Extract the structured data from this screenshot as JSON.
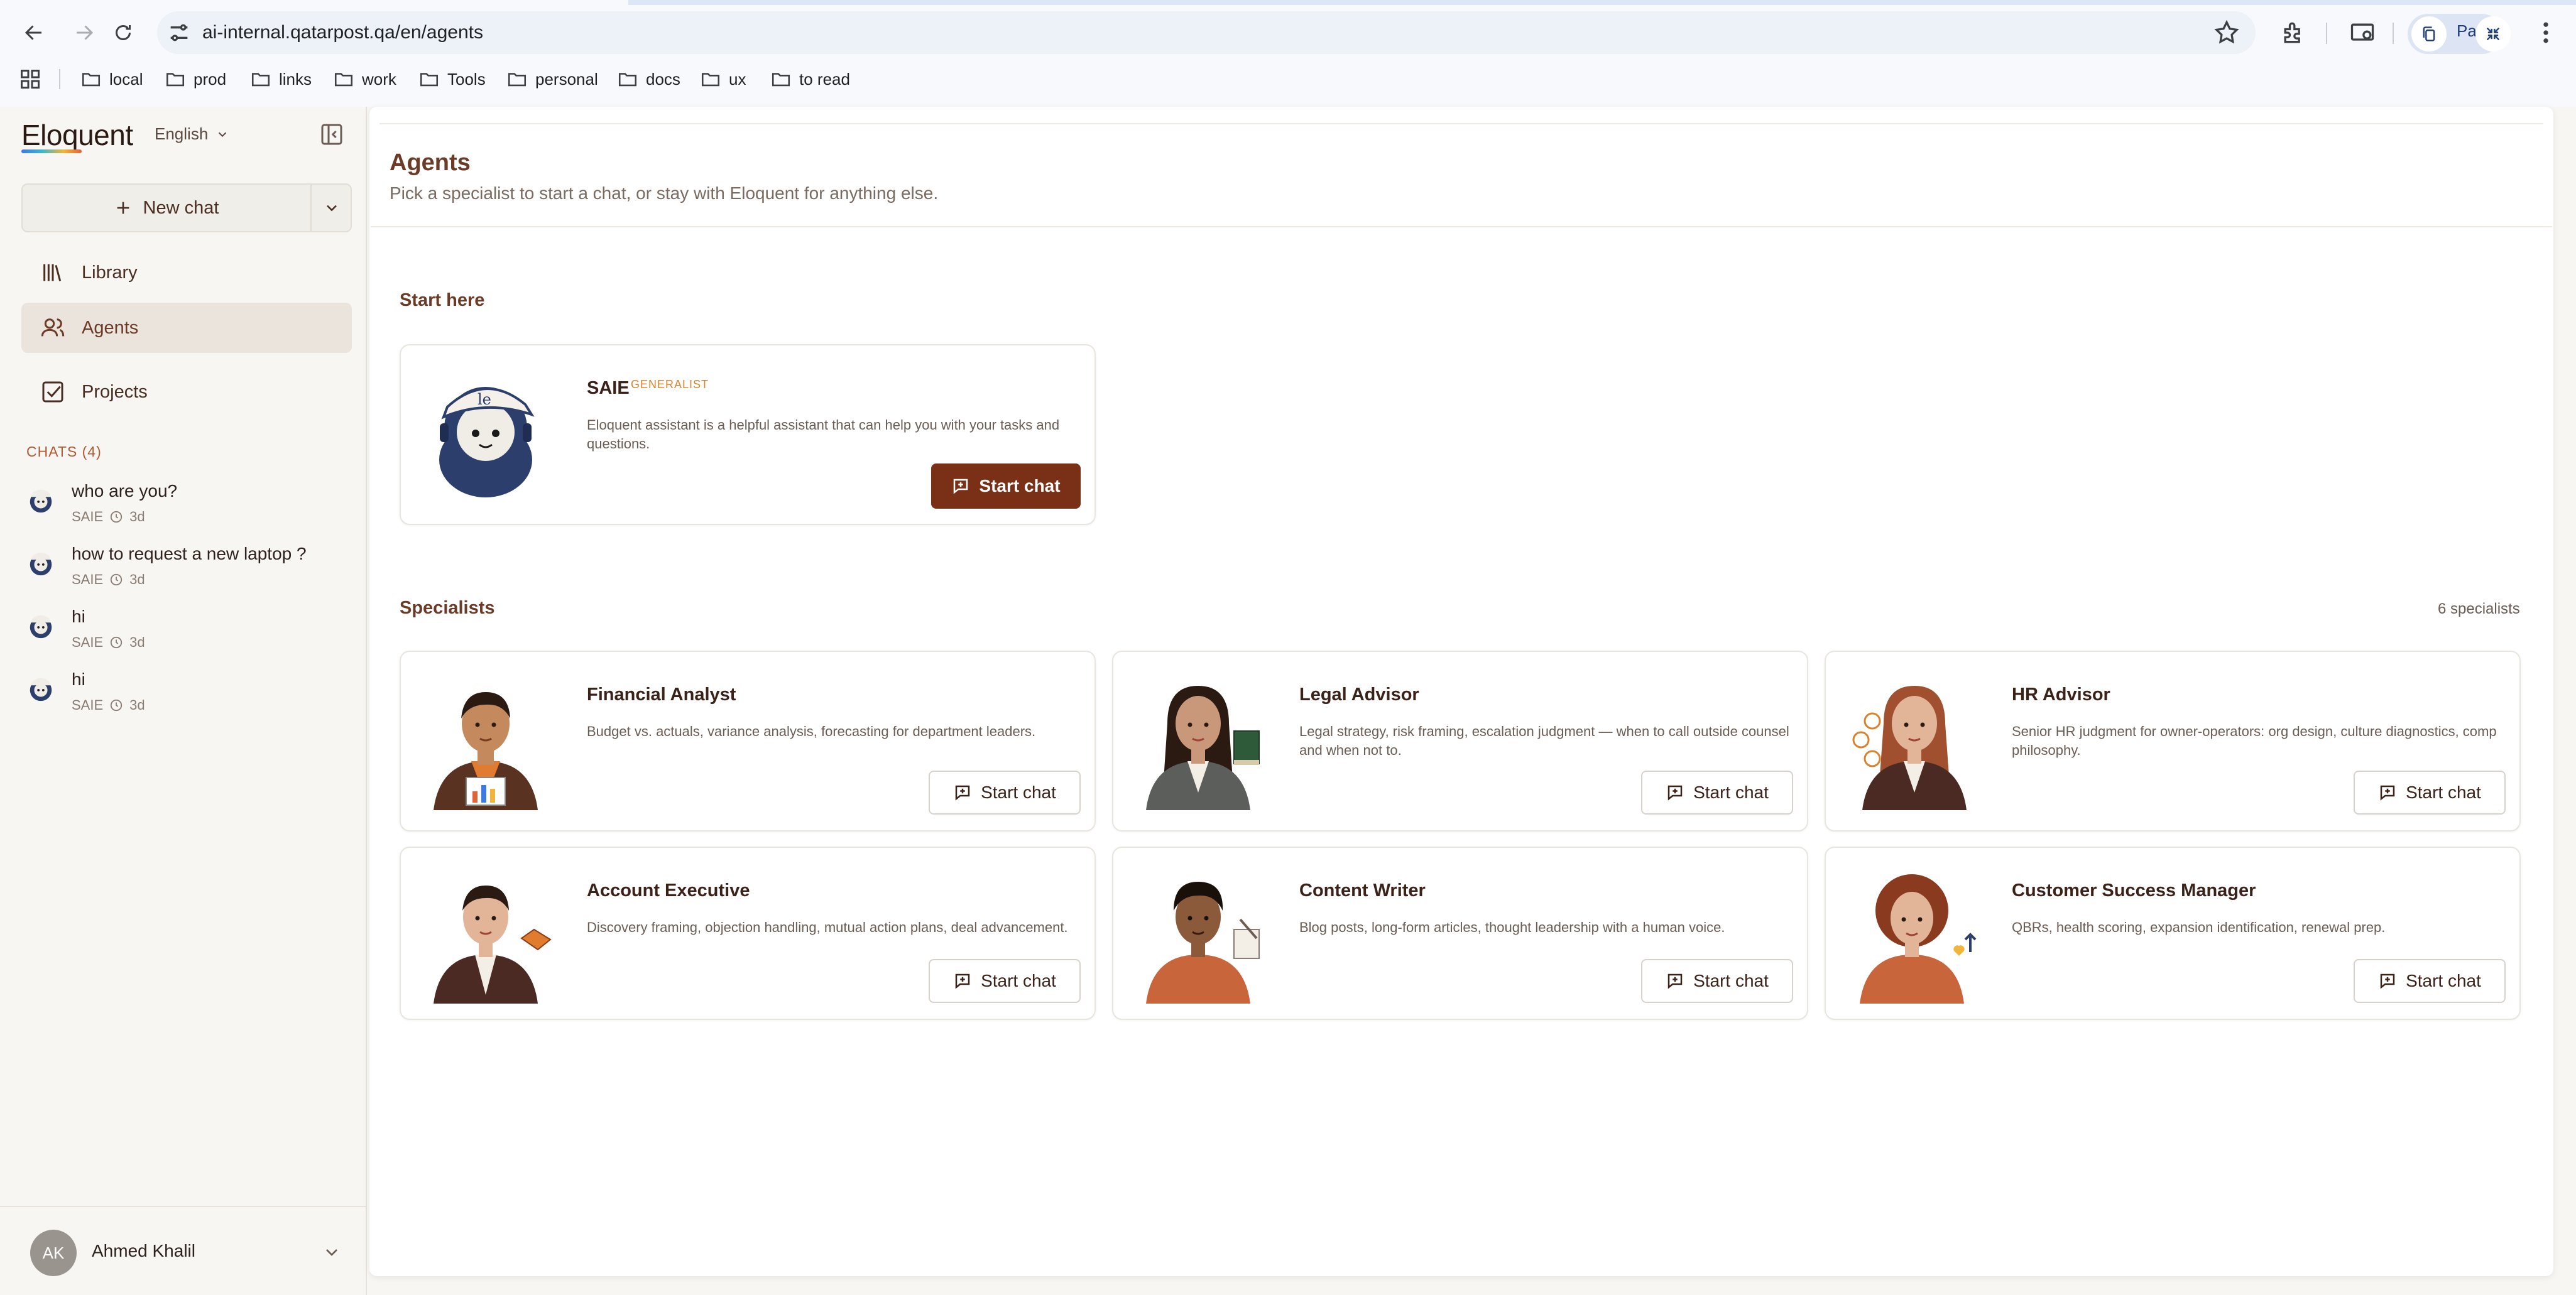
{
  "browser": {
    "url": "ai-internal.qatarpost.qa/en/agents",
    "side_panel_label": "Pa",
    "bookmarks": [
      "local",
      "prod",
      "links",
      "work",
      "Tools",
      "personal",
      "docs",
      "ux",
      "to read"
    ]
  },
  "sidebar": {
    "logo": "Eloquent",
    "language": "English",
    "new_chat_label": "New chat",
    "nav": {
      "library": "Library",
      "agents": "Agents",
      "projects": "Projects"
    },
    "chats_header": "CHATS (4)",
    "chats": [
      {
        "title": "who are you?",
        "agent": "SAIE",
        "age": "3d"
      },
      {
        "title": "how to request a new laptop ?",
        "agent": "SAIE",
        "age": "3d"
      },
      {
        "title": "hi",
        "agent": "SAIE",
        "age": "3d"
      },
      {
        "title": "hi",
        "agent": "SAIE",
        "age": "3d"
      }
    ],
    "user": {
      "initials": "AK",
      "name": "Ahmed Khalil"
    }
  },
  "main": {
    "title": "Agents",
    "subtitle": "Pick a specialist to start a chat, or stay with Eloquent for anything else.",
    "start_here": "Start here",
    "featured": {
      "name": "SAIE",
      "tag": "GENERALIST",
      "description": "Eloquent assistant is a helpful assistant that can help you with your tasks and questions.",
      "button": "Start chat"
    },
    "specialists_header": "Specialists",
    "specialists_count": "6 specialists",
    "specialists": [
      {
        "name": "Financial Analyst",
        "description": "Budget vs. actuals, variance analysis, forecasting for department leaders.",
        "button": "Start chat"
      },
      {
        "name": "Legal Advisor",
        "description": "Legal strategy, risk framing, escalation judgment — when to call outside counsel and when not to.",
        "button": "Start chat"
      },
      {
        "name": "HR Advisor",
        "description": "Senior HR judgment for owner-operators: org design, culture diagnostics, comp philosophy.",
        "button": "Start chat"
      },
      {
        "name": "Account Executive",
        "description": "Discovery framing, objection handling, mutual action plans, deal advancement.",
        "button": "Start chat"
      },
      {
        "name": "Content Writer",
        "description": "Blog posts, long-form articles, thought leadership with a human voice.",
        "button": "Start chat"
      },
      {
        "name": "Customer Success Manager",
        "description": "QBRs, health scoring, expansion identification, renewal prep.",
        "button": "Start chat"
      }
    ]
  },
  "colors": {
    "accent": "#7a3017",
    "heading": "#6b3b27",
    "tag": "#d9822b",
    "section_label": "#b25a32"
  }
}
